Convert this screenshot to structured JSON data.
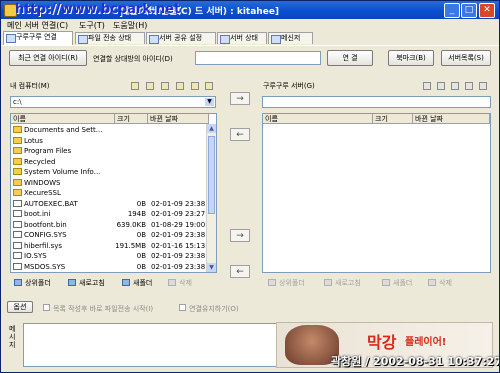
{
  "window": {
    "title": "메인 서버 연결(C) 드 서버) : kitahee]",
    "watermark": "http://www.bcpark.net",
    "min": "_",
    "max": "□",
    "close": "✕"
  },
  "menu": [
    "메인 서버 연결(C)",
    "도구(T)",
    "도움말(H)"
  ],
  "tabs": [
    "구루구루 연결",
    "파일 전송 상태",
    "서버 공유 설정",
    "서버 상태",
    "메신저"
  ],
  "toolbar": {
    "recent_button": "최근 연결 아이디(R)",
    "target_label": "연결할 상대방의 아이디(D)",
    "target_value": "",
    "connect_button": "연 결",
    "bookmark_button": "북마크(B)",
    "server_list_button": "서버목록(S)"
  },
  "local": {
    "title": "내 컴퓨터(M)",
    "path": "c:\\",
    "columns": [
      "이름",
      "크기",
      "바뀐 날짜"
    ],
    "rows": [
      {
        "name": "Documents and Sett...",
        "size": "",
        "date": "",
        "type": "folder"
      },
      {
        "name": "Lotus",
        "size": "",
        "date": "",
        "type": "folder"
      },
      {
        "name": "Program Files",
        "size": "",
        "date": "",
        "type": "folder"
      },
      {
        "name": "Recycled",
        "size": "",
        "date": "",
        "type": "folder"
      },
      {
        "name": "System Volume Info...",
        "size": "",
        "date": "",
        "type": "folder"
      },
      {
        "name": "WINDOWS",
        "size": "",
        "date": "",
        "type": "folder"
      },
      {
        "name": "XecureSSL",
        "size": "",
        "date": "",
        "type": "folder"
      },
      {
        "name": "AUTOEXEC.BAT",
        "size": "0B",
        "date": "02-01-09 23:38:02",
        "type": "file"
      },
      {
        "name": "boot.ini",
        "size": "194B",
        "date": "02-01-09 23:27:48",
        "type": "file"
      },
      {
        "name": "bootfont.bin",
        "size": "639.0KB",
        "date": "01-08-29 19:00:00",
        "type": "file"
      },
      {
        "name": "CONFIG.SYS",
        "size": "0B",
        "date": "02-01-09 23:38:02",
        "type": "file"
      },
      {
        "name": "hiberfil.sys",
        "size": "191.5MB",
        "date": "02-01-16 15:13:22",
        "type": "file"
      },
      {
        "name": "IO.SYS",
        "size": "0B",
        "date": "02-01-09 23:38:02",
        "type": "file"
      },
      {
        "name": "MSDOS.SYS",
        "size": "0B",
        "date": "02-01-09 23:38:02",
        "type": "file"
      }
    ],
    "buttons": [
      "상위폴더",
      "새로고침",
      "새폴더",
      "삭제"
    ]
  },
  "remote": {
    "title": "구루구루 서버(G)",
    "columns": [
      "이름",
      "크기",
      "바뀐 날짜"
    ],
    "buttons": [
      "상위폴더",
      "새로고침",
      "새폴더",
      "삭제"
    ]
  },
  "transfer": {
    "upload_top": "→",
    "download_top": "←",
    "upload_bottom": "→",
    "download_bottom": "←"
  },
  "bottom": {
    "options_label": "옵션",
    "auto_transfer_label": "목록 작성후 바로 파일전송 시작(I)",
    "keep_connection_label": "연결유지하기(O)",
    "message_label": "메시지"
  },
  "ad": {
    "text1": "막강",
    "text2": "플레이어!"
  },
  "stamp": "곽창원 / 2002-08-31 10:37:27"
}
